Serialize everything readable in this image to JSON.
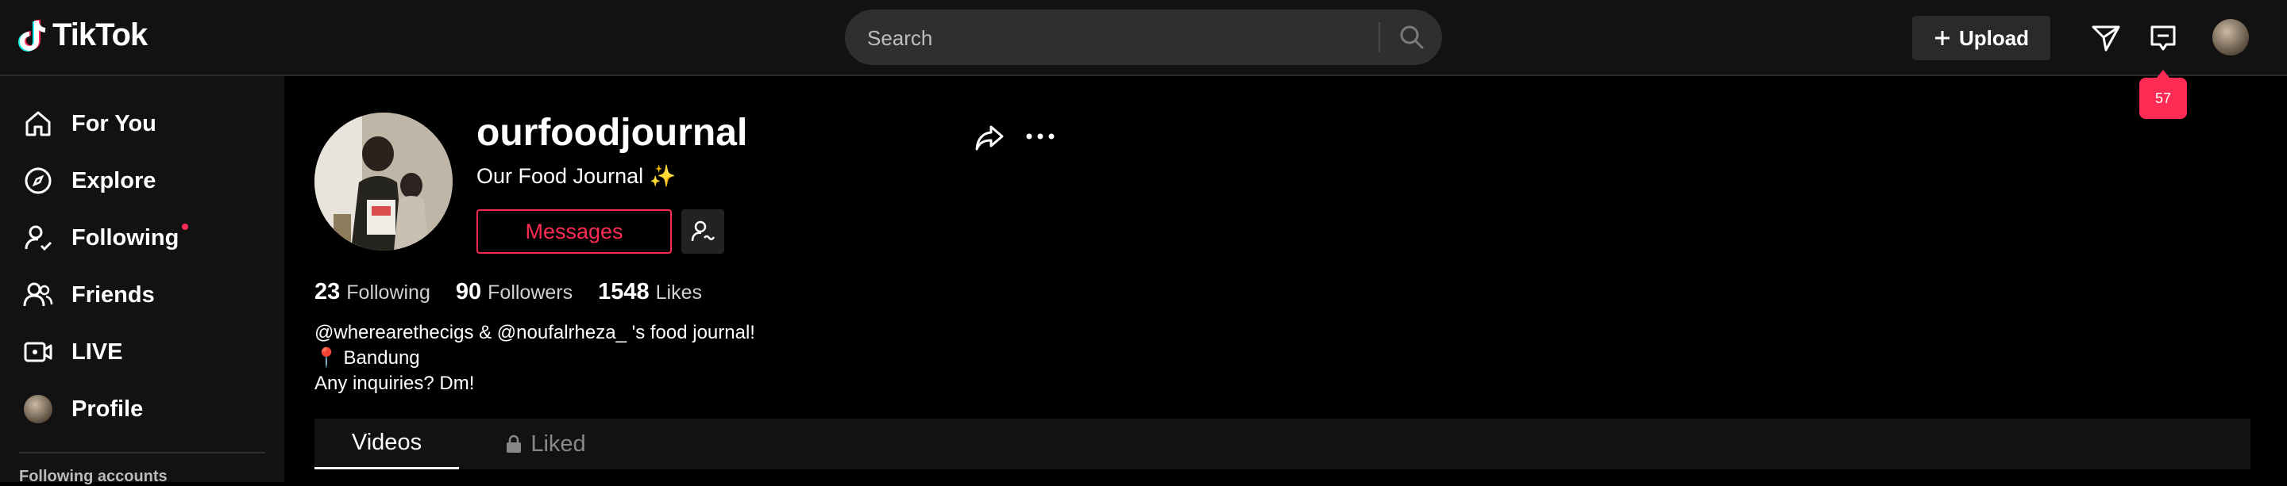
{
  "header": {
    "logo_text": "TikTok",
    "search": {
      "placeholder": "Search",
      "icon": "search-icon"
    },
    "upload_label": "Upload",
    "message_badge": "57"
  },
  "sidebar": {
    "items": [
      {
        "label": "For You",
        "icon": "home-icon"
      },
      {
        "label": "Explore",
        "icon": "compass-icon"
      },
      {
        "label": "Following",
        "icon": "user-follow-icon",
        "has_dot": true
      },
      {
        "label": "Friends",
        "icon": "friends-icon"
      },
      {
        "label": "LIVE",
        "icon": "live-icon"
      },
      {
        "label": "Profile",
        "icon": "avatar"
      }
    ],
    "footer_title": "Following accounts"
  },
  "profile": {
    "username": "ourfoodjournal",
    "nickname": "Our Food Journal ✨",
    "messages_label": "Messages",
    "stats": [
      {
        "value": "23",
        "label": "Following"
      },
      {
        "value": "90",
        "label": "Followers"
      },
      {
        "value": "1548",
        "label": "Likes"
      }
    ],
    "bio_lines": [
      "@wherearethecigs & @noufalrheza_ 's food journal!",
      "📍 Bandung",
      "Any inquiries? Dm!"
    ]
  },
  "tabs": [
    {
      "label": "Videos",
      "active": true
    },
    {
      "label": "Liked",
      "active": false,
      "locked": true
    }
  ],
  "colors": {
    "accent": "#fe2c55",
    "background": "#000000",
    "panel": "#121212"
  }
}
